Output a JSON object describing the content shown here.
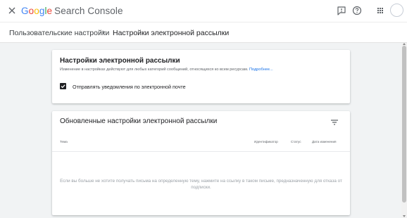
{
  "topbar": {
    "logo": {
      "g1": "G",
      "g2": "o",
      "g3": "o",
      "g4": "g",
      "g5": "l",
      "g6": "e",
      "product": "Search Console"
    },
    "icons": [
      "close-icon",
      "feedback-icon",
      "help-icon",
      "apps-icon",
      "account-avatar"
    ]
  },
  "breadcrumb": {
    "parent": "Пользовательские настройки",
    "separator": "›",
    "current": "Настройки электронной рассылки"
  },
  "email_settings_card": {
    "title": "Настройки электронной рассылки",
    "description": "Изменение в настройках действуют для любых категорий сообщений, относящихся ко всем ресурсам.",
    "link": "Подробнее...",
    "checkbox_label": "Отправлять уведомления по электронной почте",
    "checkbox_checked": true
  },
  "updated_settings_card": {
    "title": "Обновленные настройки электронной рассылки",
    "columns": [
      "Тема",
      "Идентификатор",
      "Статус",
      "Дата изменения"
    ],
    "empty_message": "Если вы больше не хотите получать письма на определенную тему, нажмите на ссылку в таком письме, предназначенную для отказа от подписки."
  },
  "colors": {
    "accent": "#1a73e8",
    "background": "#f1f3f4",
    "text_primary": "#202124",
    "text_secondary": "#5f6368"
  }
}
